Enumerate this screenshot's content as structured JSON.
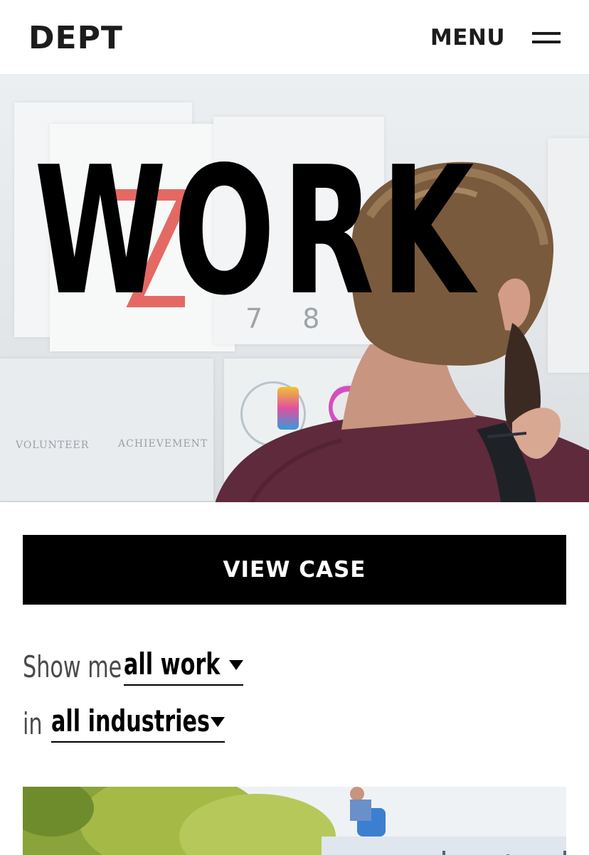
{
  "header": {
    "logo": "DEPT",
    "menu_label": "MENU"
  },
  "hero": {
    "title": "WORK",
    "background_numbers": "7 8 9 0",
    "background_logo_1": "VOLUNTEER",
    "background_logo_2": "ACHIEVEMENT"
  },
  "view_case": {
    "label": "VIEW CASE"
  },
  "filters": {
    "show_prefix": "Show me",
    "show_value": "all work",
    "in_prefix": "in",
    "in_value": "all industries"
  },
  "colors": {
    "text_dark": "#1c1c1c",
    "button_bg": "#000000",
    "button_text": "#ffffff",
    "filter_prefix": "#4a4a4a"
  },
  "icons": {
    "menu": "hamburger-icon",
    "dropdown": "chevron-down-icon"
  }
}
